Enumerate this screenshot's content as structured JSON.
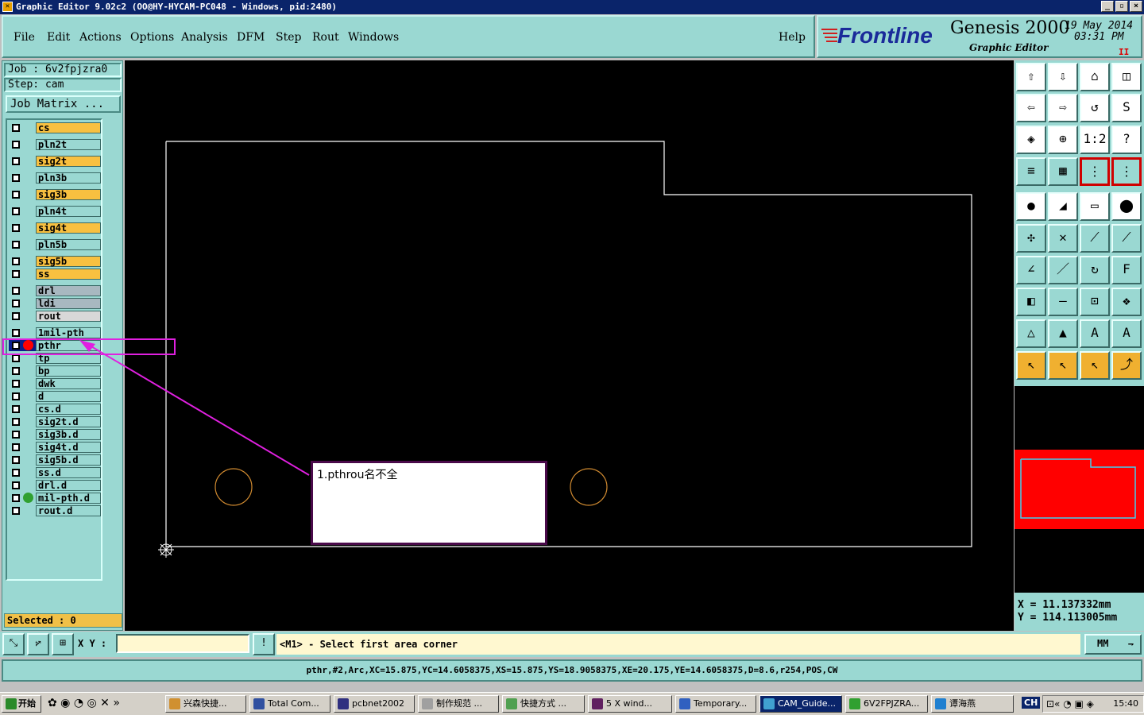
{
  "window": {
    "title": "Graphic Editor 9.02c2 (OO@HY-HYCAM-PC048 - Windows, pid:2480)",
    "buttons": [
      "_",
      "▫",
      "×"
    ]
  },
  "menu": [
    "File",
    "Edit",
    "Actions",
    "Options",
    "Analysis",
    "DFM",
    "Step",
    "Rout",
    "Windows"
  ],
  "help": "Help",
  "brand": {
    "logo": "Frontline",
    "product": "Genesis 2000",
    "subtitle": "Graphic Editor",
    "date": "19 May 2014",
    "time": "03:31 PM",
    "pause": "II"
  },
  "job": {
    "job_label": "Job : 6v2fpjzra0",
    "step_label": "Step: cam",
    "matrix_button": "Job Matrix ..."
  },
  "layers": [
    {
      "name": "cs",
      "color": "#f8c040"
    },
    {
      "name": "pln2t",
      "color": "#9ad8d2"
    },
    {
      "name": "sig2t",
      "color": "#f8c040"
    },
    {
      "name": "pln3b",
      "color": "#9ad8d2"
    },
    {
      "name": "sig3b",
      "color": "#f8c040"
    },
    {
      "name": "pln4t",
      "color": "#9ad8d2"
    },
    {
      "name": "sig4t",
      "color": "#f8c040"
    },
    {
      "name": "pln5b",
      "color": "#9ad8d2"
    },
    {
      "name": "sig5b",
      "color": "#f8c040"
    },
    {
      "name": "ss",
      "color": "#f8c040"
    },
    {
      "name": "drl",
      "color": "#a8b8c0"
    },
    {
      "name": "ldi",
      "color": "#a8b8c0"
    },
    {
      "name": "rout",
      "color": "#d8d8d8"
    },
    {
      "name": "1mil-pth",
      "color": "#9ad8d2"
    },
    {
      "name": "pthr",
      "color": "#9ad8d2"
    },
    {
      "name": "tp",
      "color": "#9ad8d2"
    },
    {
      "name": "bp",
      "color": "#9ad8d2"
    },
    {
      "name": "dwk",
      "color": "#9ad8d2"
    },
    {
      "name": "d",
      "color": "#9ad8d2"
    },
    {
      "name": "cs.d",
      "color": "#9ad8d2"
    },
    {
      "name": "sig2t.d",
      "color": "#9ad8d2"
    },
    {
      "name": "sig3b.d",
      "color": "#9ad8d2"
    },
    {
      "name": "sig4t.d",
      "color": "#9ad8d2"
    },
    {
      "name": "sig5b.d",
      "color": "#9ad8d2"
    },
    {
      "name": "ss.d",
      "color": "#9ad8d2"
    },
    {
      "name": "drl.d",
      "color": "#9ad8d2"
    },
    {
      "name": "mil-pth.d",
      "color": "#9ad8d2"
    },
    {
      "name": "rout.d",
      "color": "#9ad8d2"
    }
  ],
  "selected": "Selected : 0",
  "annotation": "1.pthrou名不全",
  "coords": {
    "x": "X  =  11.137332mm",
    "y": "Y  =  114.113005mm"
  },
  "cmd": {
    "xy_label": "X Y :",
    "info_btn": "!",
    "prompt": "<M1> - Select first area corner",
    "units": "MM"
  },
  "status": "pthr,#2,Arc,XC=15.875,YC=14.6058375,XS=15.875,YS=18.9058375,XE=20.175,YE=14.6058375,D=8.6,r254,POS,CW",
  "taskbar": {
    "start": "开始",
    "tasks": [
      "兴森快捷...",
      "Total Com...",
      "pcbnet2002",
      "制作规范 ...",
      "快捷方式 ...",
      "5 X wind...",
      "Temporary...",
      "CAM_Guide...",
      "6V2FPJZRA...",
      "谭海燕"
    ],
    "lang": "CH",
    "clock": "15:40"
  },
  "colors": {
    "panel": "#9ad8d2",
    "canvas": "#000000",
    "highlight": "#e020e0",
    "accent": "#f8c040"
  }
}
